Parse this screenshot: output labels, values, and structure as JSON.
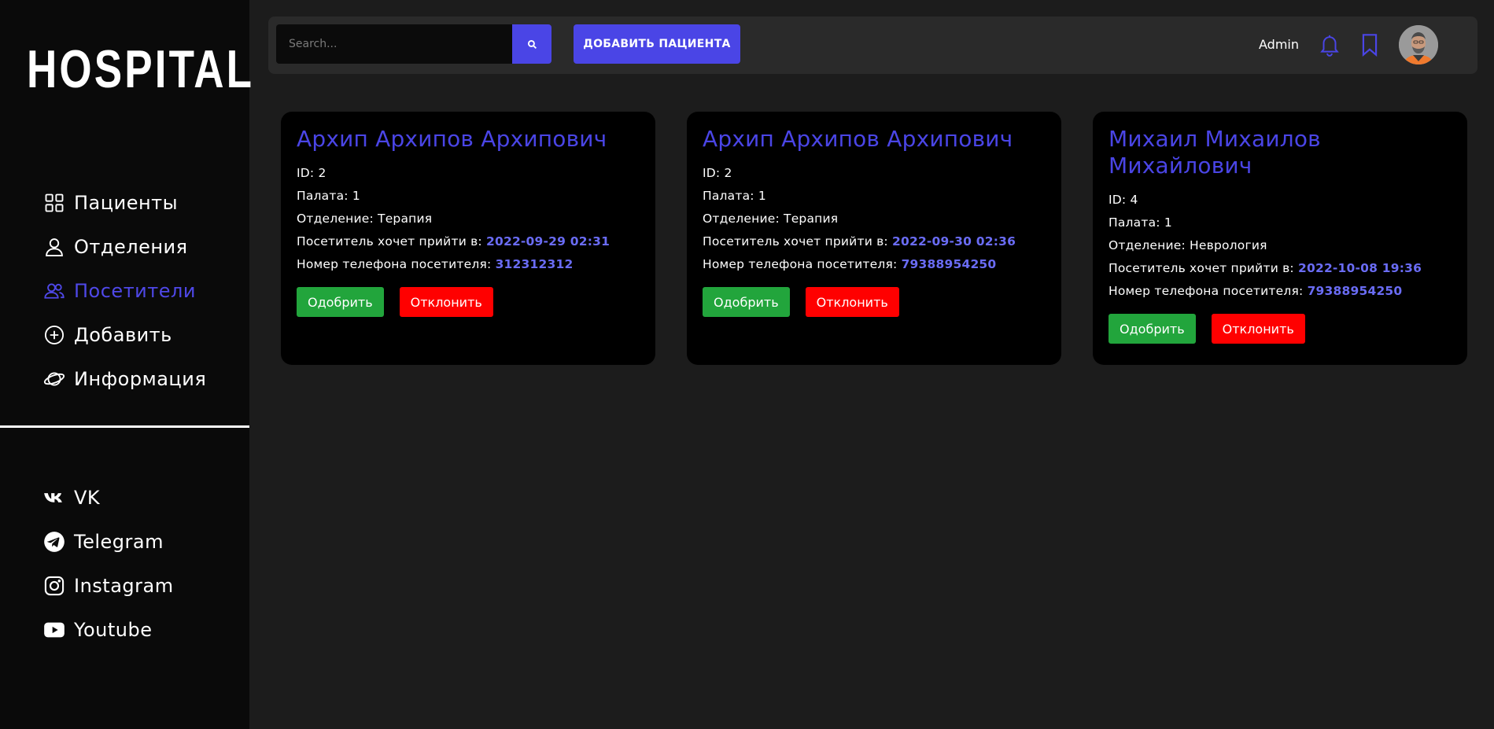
{
  "sidebar": {
    "logo": "HOSPITAL",
    "nav": [
      {
        "label": "Пациенты",
        "icon": "grid-icon",
        "active": false
      },
      {
        "label": "Отделения",
        "icon": "user-icon",
        "active": false
      },
      {
        "label": "Посетители",
        "icon": "users-icon",
        "active": true
      },
      {
        "label": "Добавить",
        "icon": "plus-circle-icon",
        "active": false
      },
      {
        "label": "Информация",
        "icon": "planet-icon",
        "active": false
      }
    ],
    "social": [
      {
        "label": "VK",
        "icon": "vk-icon"
      },
      {
        "label": "Telegram",
        "icon": "telegram-icon"
      },
      {
        "label": "Instagram",
        "icon": "instagram-icon"
      },
      {
        "label": "Youtube",
        "icon": "youtube-icon"
      }
    ]
  },
  "topbar": {
    "search_placeholder": "Search...",
    "add_patient_label": "ДОБАВИТЬ ПАЦИЕНТА",
    "user_name": "Admin"
  },
  "labels": {
    "id": "ID: ",
    "ward": "Палата: ",
    "department": "Отделение: ",
    "visit_time": "Посетитель хочет прийти в: ",
    "phone": "Номер телефона посетителя: ",
    "approve": "Одобрить",
    "reject": "Отклонить"
  },
  "requests": [
    {
      "name": "Архип Архипов Архипович",
      "id": "2",
      "ward": "1",
      "department": "Терапия",
      "visit_time": "2022-09-29 02:31",
      "phone": "312312312"
    },
    {
      "name": "Архип Архипов Архипович",
      "id": "2",
      "ward": "1",
      "department": "Терапия",
      "visit_time": "2022-09-30 02:36",
      "phone": "79388954250"
    },
    {
      "name": "Михаил Михаилов Михайлович",
      "id": "4",
      "ward": "1",
      "department": "Неврология",
      "visit_time": "2022-10-08 19:36",
      "phone": "79388954250"
    }
  ],
  "colors": {
    "accent": "#4a45e6",
    "approve": "#22a53c",
    "reject": "#ff0000",
    "highlight": "#6a6cf5"
  }
}
